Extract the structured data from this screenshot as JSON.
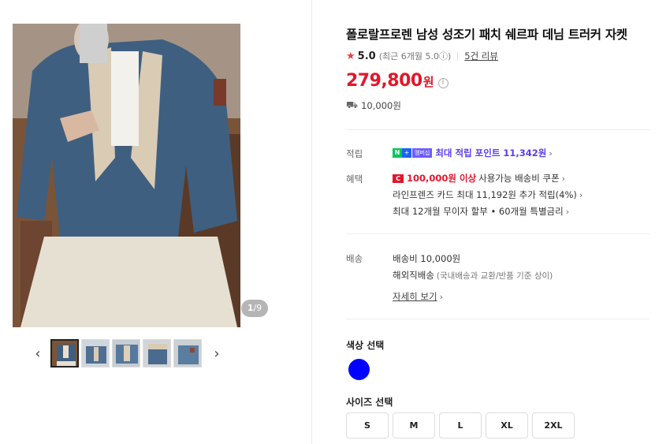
{
  "gallery": {
    "counter_current": "1",
    "counter_total": "/9",
    "prev_label": "‹",
    "next_label": "›",
    "thumbnail_count": 5
  },
  "product": {
    "title": "폴로랄프로렌 남성 성조기 패치 쉐르파 데님 트러커 자켓",
    "rating_score": "5.0",
    "rating_recent": "(최근 6개월 5.0",
    "rating_info_icon": "ⓘ",
    "rating_recent_close": ")",
    "review_link": "5건 리뷰",
    "price": "279,800",
    "price_unit": "원",
    "price_info_icon": "i",
    "shipping_fee": "10,000원"
  },
  "benefits": {
    "points_label": "적립",
    "points_badge_n": "N",
    "points_badge_plus": "+",
    "points_badge_member": "멤버십",
    "points_text": "최대 적립 포인트 11,342원",
    "benefit_label": "혜택",
    "coupon_icon_text": "C",
    "coupon_amount": "100,000원 이상",
    "coupon_text": "사용가능 배송비 쿠폰",
    "card_text": "라인프렌즈 카드 최대 11,192원 추가 적립(4%)",
    "installment_text": "최대 12개월 무이자 할부 • 60개월 특별금리",
    "chevron": "›"
  },
  "delivery": {
    "label": "배송",
    "fee_text": "배송비 10,000원",
    "overseas_text": "해외직배송",
    "overseas_note": "(국내배송과 교환/반품 기준 상이)",
    "detail_link": "자세히 보기"
  },
  "options": {
    "color_title": "색상 선택",
    "color_swatch": "#0000ff",
    "size_title": "사이즈 선택",
    "sizes": [
      "S",
      "M",
      "L",
      "XL",
      "2XL"
    ]
  },
  "icons": {
    "star": "star-icon",
    "truck": "truck-icon",
    "info": "info-icon"
  }
}
